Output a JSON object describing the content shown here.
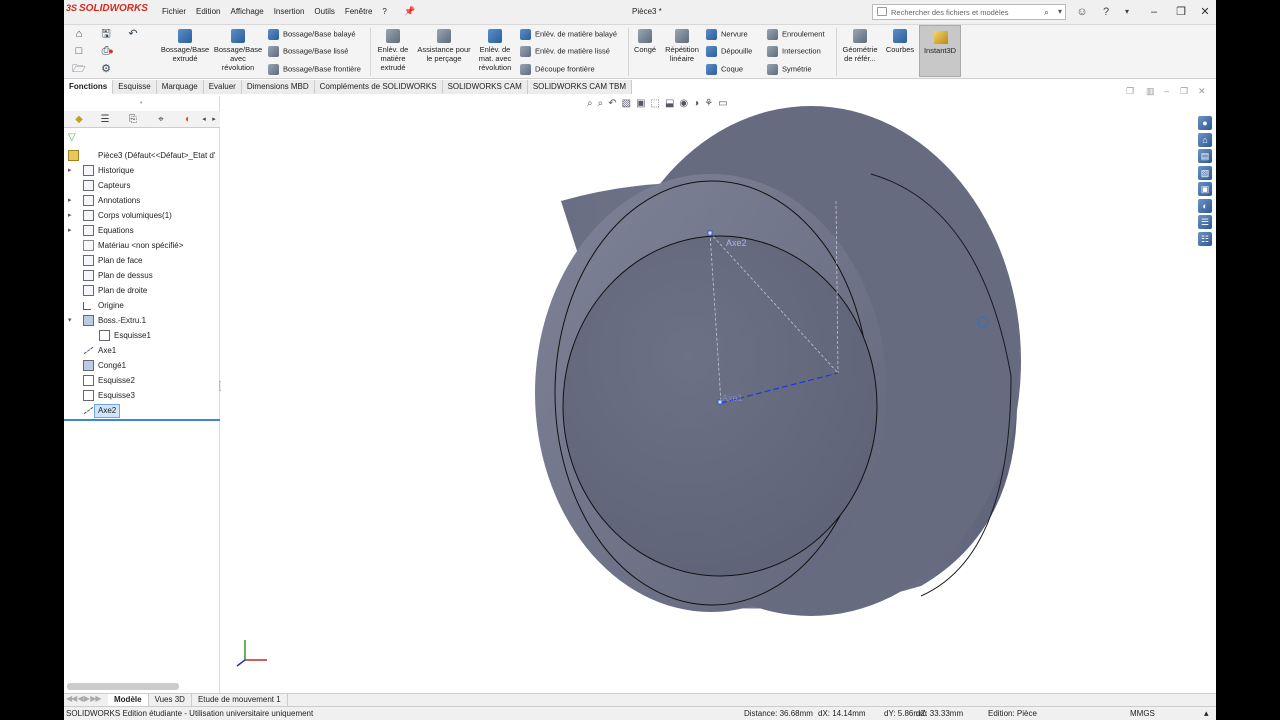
{
  "app": {
    "brand": "SOLIDWORKS",
    "brand_prefix": "3S",
    "doc_title": "Pièce3 *"
  },
  "menus": [
    "Fichier",
    "Edition",
    "Affichage",
    "Insertion",
    "Outils",
    "Fenêtre",
    "?"
  ],
  "search": {
    "placeholder": "Rechercher des fichiers et modèles"
  },
  "ribbon": {
    "bossage_extrude": "Bossage/Base extrudé",
    "bossage_revolution": "Bossage/Base avec révolution",
    "bossage_balaye": "Bossage/Base balayé",
    "bossage_lisse": "Bossage/Base lissé",
    "bossage_frontiere": "Bossage/Base frontière",
    "enlev_extrude": "Enlèv. de matière extrudé",
    "assistance_percage": "Assistance pour le perçage",
    "enlev_revolution": "Enlèv. de mat. avec révolution",
    "enlev_balaye": "Enlèv. de matière balayé",
    "enlev_lisse": "Enlèv. de matière lissé",
    "decoupe_frontiere": "Découpe frontière",
    "conge": "Congé",
    "repetition_lineaire": "Répétition linéaire",
    "nervure": "Nervure",
    "depouille": "Dépouille",
    "coque": "Coque",
    "enroulement": "Enroulement",
    "intersection": "Intersection",
    "symetrie": "Symétrie",
    "geometrie_ref": "Géométrie de référ...",
    "courbes": "Courbes",
    "instant3d": "Instant3D"
  },
  "command_tabs": [
    "Fonctions",
    "Esquisse",
    "Marquage",
    "Evaluer",
    "Dimensions MBD",
    "Compléments de SOLIDWORKS",
    "SOLIDWORKS CAM",
    "SOLIDWORKS CAM TBM"
  ],
  "tree": {
    "root": "Pièce3  (Défaut<<Défaut>_Etat d'",
    "items": [
      "Historique",
      "Capteurs",
      "Annotations",
      "Corps volumiques(1)",
      "Equations",
      "Matériau <non spécifié>",
      "Plan de face",
      "Plan de dessus",
      "Plan de droite",
      "Origine",
      "Boss.-Extru.1",
      "Esquisse1",
      "Axe1",
      "Congé1",
      "Esquisse2",
      "Esquisse3",
      "Axe2"
    ]
  },
  "viewport": {
    "label_axe2": "Axe2",
    "label_axe1": "Axe1"
  },
  "bottom_tabs": [
    "Modèle",
    "Vues 3D",
    "Etude de mouvement 1"
  ],
  "status": {
    "edition": "SOLIDWORKS Edition étudiante - Utilisation universitaire uniquement",
    "distance": "Distance: 36.68mm",
    "dx": "dX: 14.14mm",
    "dy": "dY: 5.86mm",
    "dz": "dZ: 33.33mm",
    "mode": "Edition: Pièce",
    "units": "MMGS"
  },
  "colors": {
    "brand": "#d52b1e",
    "part": "#6d7186",
    "selection": "#1c3ad6"
  }
}
